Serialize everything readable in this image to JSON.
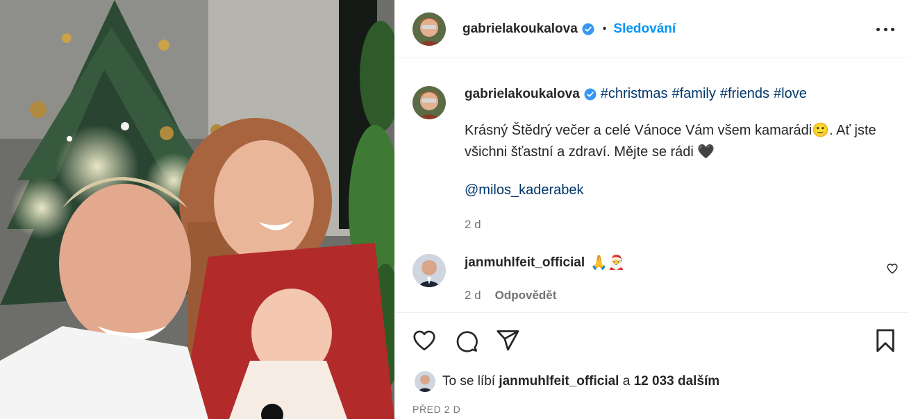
{
  "post": {
    "author": "gabrielakoukalova",
    "follow_label": "Sledování",
    "separator": "•",
    "more_label": "Další možnosti"
  },
  "caption": {
    "author": "gabrielakoukalova",
    "hashtags": [
      "#christmas",
      "#family",
      "#friends",
      "#love"
    ],
    "text": "Krásný Štědrý večer a celé Vánoce Vám všem kamarádi🙂. Ať jste všichni šťastní a zdraví. Mějte se rádi 🖤",
    "mention": "@milos_kaderabek",
    "age": "2 d"
  },
  "comment": {
    "author": "janmuhlfeit_official",
    "emojis": "🙏🎅",
    "age": "2 d",
    "reply_label": "Odpovědět"
  },
  "likes": {
    "prefix": "To se líbí ",
    "user": "janmuhlfeit_official",
    "middle": " a ",
    "count": "12 033 dalším"
  },
  "date": "PŘED 2 D",
  "icons": {
    "like": "heart-icon",
    "comment": "comment-icon",
    "share": "send-icon",
    "save": "bookmark-icon",
    "verified": "verified-badge-icon"
  },
  "colors": {
    "link": "#00376b",
    "follow": "#0095f6",
    "verified": "#3897f0",
    "muted": "#737373",
    "text": "#262626"
  }
}
